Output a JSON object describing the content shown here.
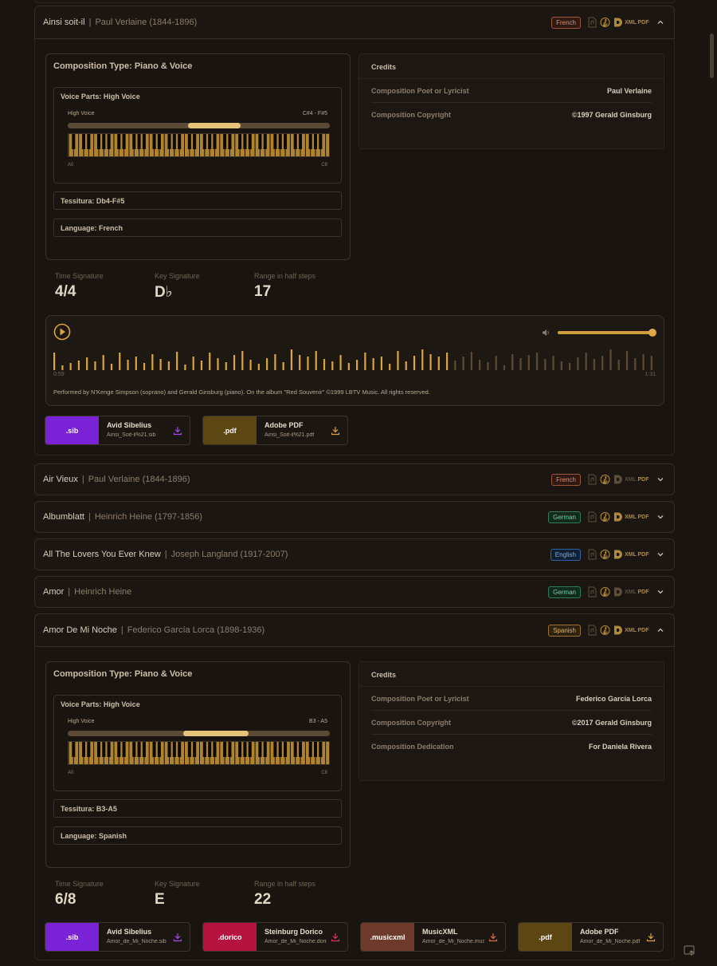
{
  "colors": {
    "accent": "#d9a441",
    "sib": "#7a22d6",
    "pdf": "#5b4614",
    "dorico": "#b5123f",
    "musicxml": "#6e3a2c"
  },
  "rows": [
    {
      "title": "Ainsi soit-il",
      "author": "Paul Verlaine (1844-1896)",
      "language": "French",
      "expanded": true
    },
    {
      "title": "Air Vieux",
      "author": "Paul Verlaine (1844-1896)",
      "language": "French",
      "expanded": false
    },
    {
      "title": "Albumblatt",
      "author": "Heinrich Heine (1797-1856)",
      "language": "German",
      "expanded": false
    },
    {
      "title": "All The Lovers You Ever Knew",
      "author": "Joseph Langland (1917-2007)",
      "language": "English",
      "expanded": false
    },
    {
      "title": "Amor",
      "author": "Heinrich Heine",
      "language": "German",
      "expanded": false
    },
    {
      "title": "Amor De Mi Noche",
      "author": "Federico García Lorca (1898-1936)",
      "language": "Spanish",
      "expanded": true
    }
  ],
  "separator": "|",
  "icon_names": [
    "file-audio-icon",
    "treble-clef-icon",
    "dorico-icon",
    "xml-icon",
    "pdf-icon",
    "chevron-icon"
  ],
  "icon_text": {
    "xml": "XML",
    "pdf": "PDF"
  },
  "detail1": {
    "composition_type": "Composition Type: Piano & Voice",
    "voice_parts": "Voice Parts: High Voice",
    "voice_label": "High Voice",
    "range": "C#4 - F#5",
    "range_fill": [
      0.46,
      0.66
    ],
    "low_note": "A0",
    "high_note": "C8",
    "tessitura": "Tessitura: Db4-F#5",
    "language": "Language: French",
    "credits_header": "Credits",
    "credits": [
      {
        "k": "Composition Poet or Lyricist",
        "v": "Paul Verlaine"
      },
      {
        "k": "Composition Copyright",
        "v": "©1997 Gerald Ginsburg"
      }
    ],
    "stats": [
      {
        "label": "Time Signature",
        "value": "4/4"
      },
      {
        "label": "Key Signature",
        "value": "D♭"
      },
      {
        "label": "Range in half steps",
        "value": "17"
      }
    ],
    "player": {
      "time_start": "0:59",
      "time_end": "1:31",
      "progress": 0.66,
      "volume": 1.0,
      "credit": "Performed by N'Kenge Simpson (soprano) and Gerald Ginsburg (piano). On the album \"Red Souvenir\" ©1999 LBTV Music. All rights reserved."
    },
    "downloads": [
      {
        "ext": ".sib",
        "name": "Avid Sibelius",
        "file": "Ainsi_Soit-il%21.sib"
      },
      {
        "ext": ".pdf",
        "name": "Adobe PDF",
        "file": "Ainsi_Soit-il%21.pdf"
      }
    ]
  },
  "detail2": {
    "composition_type": "Composition Type: Piano & Voice",
    "voice_parts": "Voice Parts: High Voice",
    "voice_label": "High Voice",
    "range": "B3 - A5",
    "range_fill": [
      0.44,
      0.69
    ],
    "low_note": "A0",
    "high_note": "C8",
    "tessitura": "Tessitura: B3-A5",
    "language": "Language: Spanish",
    "credits_header": "Credits",
    "credits": [
      {
        "k": "Composition Poet or Lyricist",
        "v": "Federico García Lorca"
      },
      {
        "k": "Composition Copyright",
        "v": "©2017 Gerald Ginsburg"
      },
      {
        "k": "Composition Dedication",
        "v": "For Daniela Rivera"
      }
    ],
    "stats": [
      {
        "label": "Time Signature",
        "value": "6/8"
      },
      {
        "label": "Key Signature",
        "value": "E"
      },
      {
        "label": "Range in half steps",
        "value": "22"
      }
    ],
    "downloads": [
      {
        "ext": ".sib",
        "name": "Avid Sibelius",
        "file": "Amor_de_Mi_Noche.sib"
      },
      {
        "ext": ".dorico",
        "name": "Steinburg Dorico",
        "file": "Amor_de_Mi_Noche.dorico"
      },
      {
        "ext": ".musicxml",
        "name": "MusicXML",
        "file": "Amor_de_Mi_Noche.musicxml"
      },
      {
        "ext": ".pdf",
        "name": "Adobe PDF",
        "file": "Amor_de_Mi_Noche.pdf"
      }
    ]
  }
}
